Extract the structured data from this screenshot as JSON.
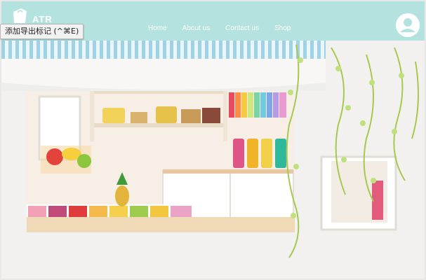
{
  "brand": {
    "name_partial": "ATR"
  },
  "tooltip": {
    "text": "添加导出标记 (^⌘E)"
  },
  "nav": {
    "links": [
      "Home",
      "About us",
      "Contact us",
      "Shop"
    ]
  },
  "colors": {
    "navbar": "#b4e2de",
    "nav_text": "#ffffff",
    "awning_stripe": "#9fd2e3"
  },
  "icons": {
    "logo": "shopping-bag-logo",
    "account": "user-account-icon"
  },
  "hero": {
    "description": "Illustration of a juice-bar kiosk window with striped awning, fruit display, shelves, juice blenders and hanging green vines"
  }
}
